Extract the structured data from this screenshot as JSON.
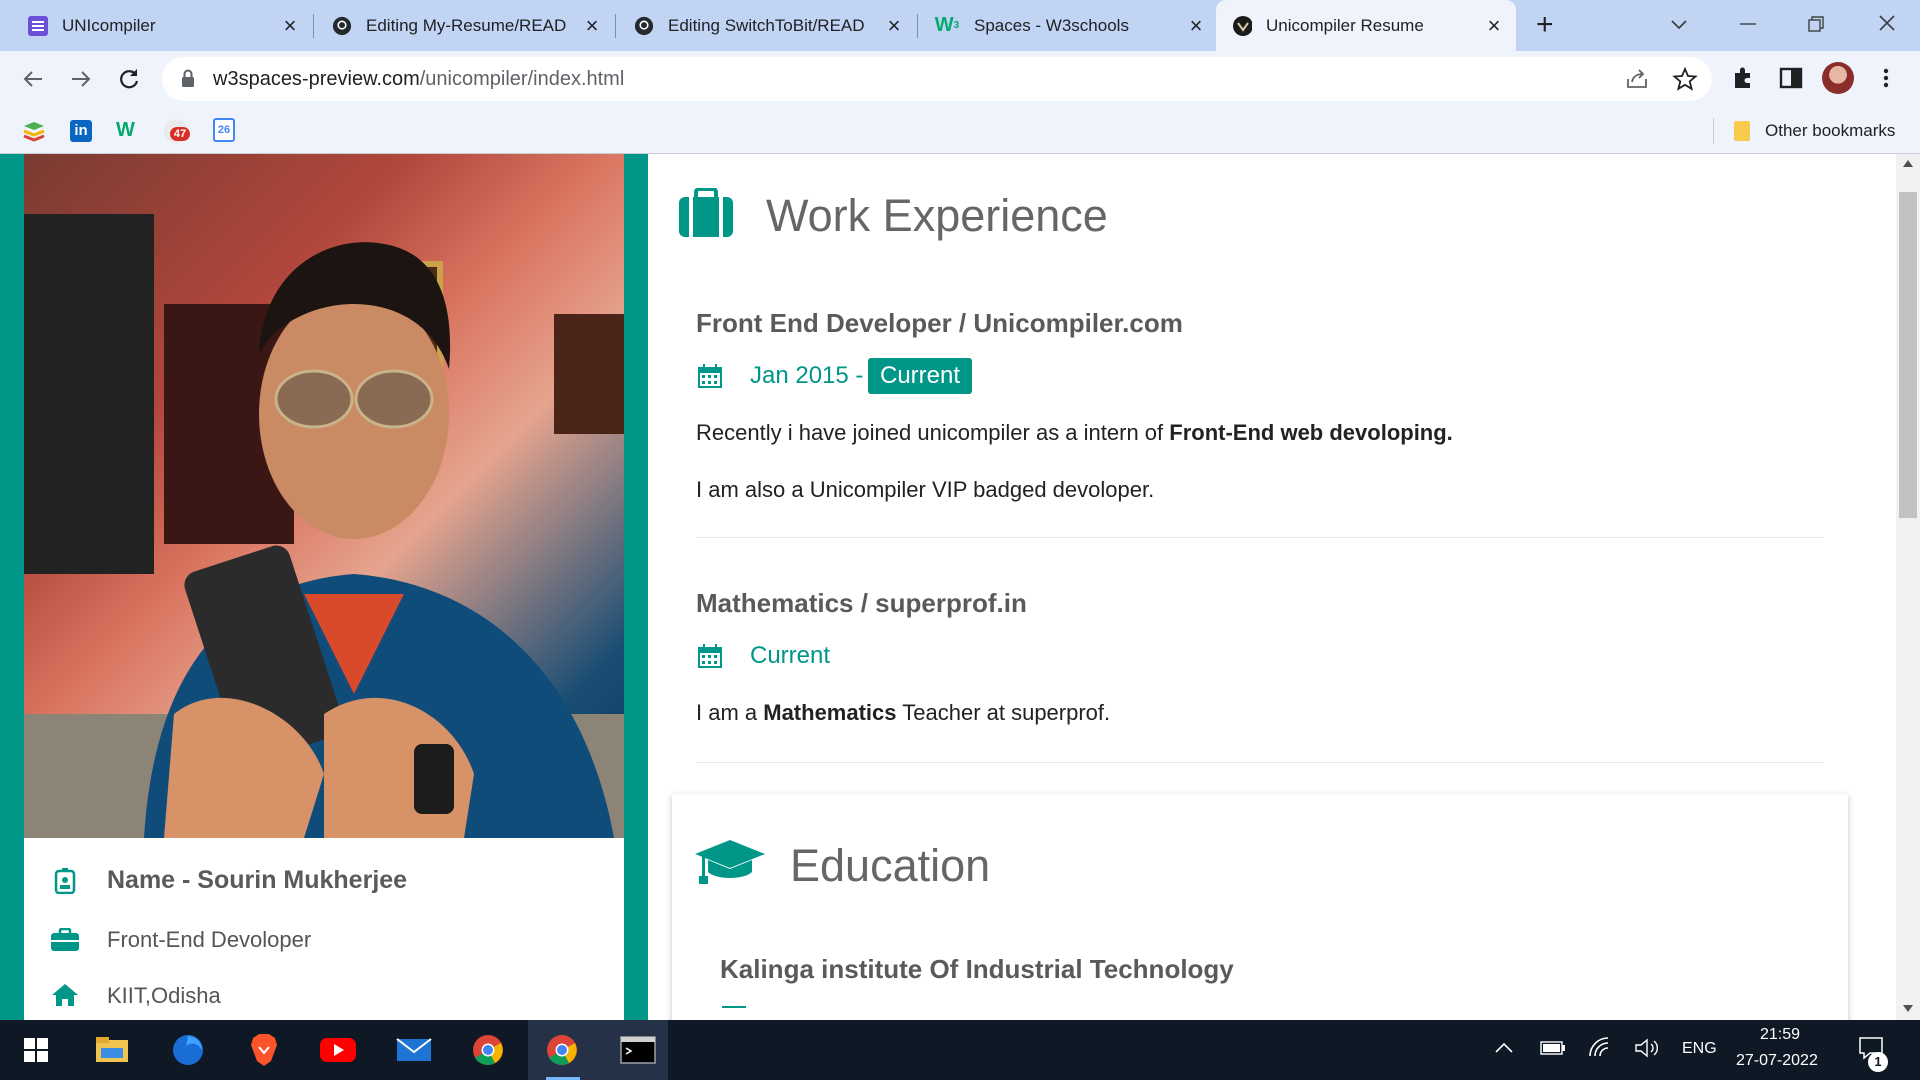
{
  "browser": {
    "tabs": [
      {
        "title": "UNIcompiler",
        "icon": "list-icon"
      },
      {
        "title": "Editing My-Resume/READ",
        "icon": "github-icon"
      },
      {
        "title": "Editing SwitchToBit/READ",
        "icon": "github-icon"
      },
      {
        "title": "Spaces - W3schools",
        "icon": "w3-icon"
      },
      {
        "title": "Unicompiler Resume",
        "icon": "site-icon"
      }
    ],
    "url_host": "w3spaces-preview.com",
    "url_path": "/unicompiler/index.html",
    "bookmarks": [
      {
        "icon": "stack-icon"
      },
      {
        "icon": "linkedin-icon",
        "text": "in"
      },
      {
        "icon": "w3-icon",
        "text": "W"
      },
      {
        "icon": "gmail-icon",
        "text": "47"
      },
      {
        "icon": "calendar-icon",
        "text": "26"
      }
    ],
    "other_bookmarks": "Other bookmarks"
  },
  "profile": {
    "name": "Name - Sourin Mukherjee",
    "job": "Front-End Devoloper",
    "location": "KIIT,Odisha"
  },
  "work": {
    "heading": "Work Experience",
    "jobs": [
      {
        "title": "Front End Developer / Unicompiler.com",
        "date": "Jan 2015 -",
        "badge": "Current",
        "para1_pre": "Recently i have joined unicompiler as a intern of ",
        "para1_bold": "Front-End web devoloping.",
        "para2": "I am also a Unicompiler VIP badged devoloper."
      },
      {
        "title": "Mathematics / superprof.in",
        "date": "Current",
        "para_pre": "I am a ",
        "para_bold": "Mathematics",
        "para_post": " Teacher at superprof."
      }
    ]
  },
  "education": {
    "heading": "Education",
    "school": "Kalinga institute Of Industrial Technology"
  },
  "taskbar": {
    "lang": "ENG",
    "time": "21:59",
    "date": "27-07-2022",
    "notification_count": "1"
  },
  "colors": {
    "accent": "#009688",
    "tabstrip": "#c2d4f4",
    "toolbar": "#eff3fb"
  }
}
